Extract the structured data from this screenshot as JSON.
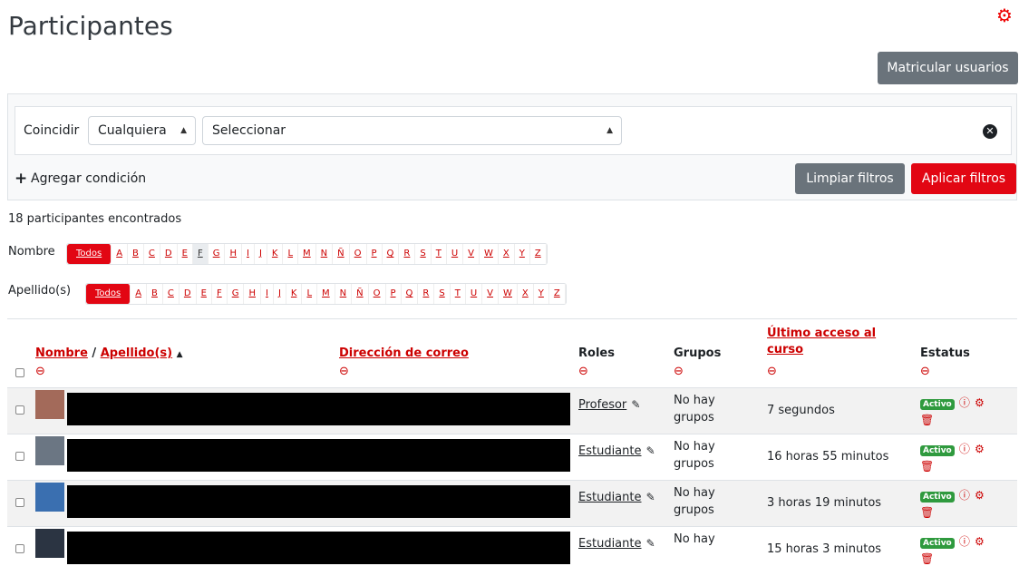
{
  "page": {
    "title": "Participantes"
  },
  "header": {
    "enrol_label": "Matricular usuarios"
  },
  "filter": {
    "match_label": "Coincidir",
    "match_value": "Cualquiera",
    "select_value": "Seleccionar",
    "add_condition": "Agregar condición",
    "clear_label": "Limpiar filtros",
    "apply_label": "Aplicar filtros"
  },
  "count_text": "18 participantes encontrados",
  "alpha": {
    "first_label": "Nombre",
    "last_label": "Apellido(s)",
    "all_label": "Todos",
    "letters": [
      "A",
      "B",
      "C",
      "D",
      "E",
      "F",
      "G",
      "H",
      "I",
      "J",
      "K",
      "L",
      "M",
      "N",
      "Ñ",
      "O",
      "P",
      "Q",
      "R",
      "S",
      "T",
      "U",
      "V",
      "W",
      "X",
      "Y",
      "Z"
    ]
  },
  "table": {
    "col_first": "Nombre",
    "col_sep": " / ",
    "col_last": "Apellido(s)",
    "col_email": "Dirección de correo",
    "col_roles": "Roles",
    "col_groups": "Grupos",
    "col_access_1": "Último acceso al",
    "col_access_2": "curso",
    "col_status": "Estatus",
    "rows": [
      {
        "role": "Profesor",
        "groups_1": "No hay",
        "groups_2": "grupos",
        "access": "7 segundos",
        "status": "Activo"
      },
      {
        "role": "Estudiante",
        "groups_1": "No hay",
        "groups_2": "grupos",
        "access": "16 horas 55 minutos",
        "status": "Activo"
      },
      {
        "role": "Estudiante",
        "groups_1": "No hay",
        "groups_2": "grupos",
        "access": "3 horas 19 minutos",
        "status": "Activo"
      },
      {
        "role": "Estudiante",
        "groups_1": "No hay",
        "groups_2": "",
        "access": "15 horas 3 minutos",
        "status": "Activo"
      }
    ]
  },
  "colors": {
    "accent": "#e20613",
    "secondary_button": "#6a737b",
    "badge_active": "#2f9a3e"
  }
}
